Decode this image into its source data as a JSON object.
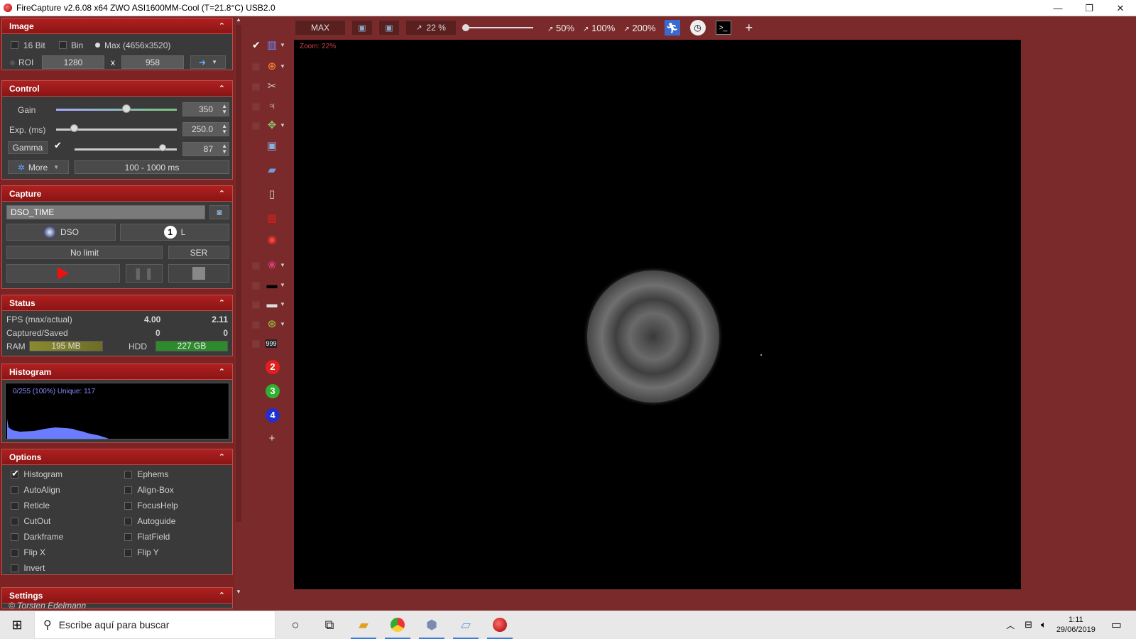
{
  "titlebar": {
    "title": "FireCapture v2.6.08  x64    ZWO ASI1600MM-Cool (T=21.8°C) USB2.0",
    "minimize": "—",
    "restore": "❐",
    "close": "✕"
  },
  "image": {
    "header": "Image",
    "bit16": "16 Bit",
    "bin": "Bin",
    "max": "Max (4656x3520)",
    "roi": "ROI",
    "roi_w": "1280",
    "x": "x",
    "roi_h": "958"
  },
  "control": {
    "header": "Control",
    "gain_label": "Gain",
    "gain_value": "350",
    "gain_level": 0.58,
    "exp_label": "Exp. (ms)",
    "exp_value": "250.0",
    "exp_level": 0.15,
    "gamma_label": "Gamma",
    "gamma_value": "87",
    "gamma_level": 0.87,
    "more": "More",
    "range": "100 - 1000 ms"
  },
  "capture": {
    "header": "Capture",
    "profile": "DSO_TIME",
    "mode": "DSO",
    "filter_num": "1",
    "filter": "L",
    "limit": "No limit",
    "format": "SER"
  },
  "status": {
    "header": "Status",
    "fps_label": "FPS (max/actual)",
    "fps_max": "4.00",
    "fps_actual": "2.11",
    "cap_label": "Captured/Saved",
    "captured": "0",
    "saved": "0",
    "ram_label": "RAM",
    "ram_value": "195 MB",
    "hdd_label": "HDD",
    "hdd_value": "227 GB"
  },
  "histogram": {
    "header": "Histogram",
    "info": "0/255 (100%)  Unique: 117"
  },
  "options": {
    "header": "Options",
    "histogram": "Histogram",
    "ephems": "Ephems",
    "autoalign": "AutoAlign",
    "alignbox": "Align-Box",
    "reticle": "Reticle",
    "focushelp": "FocusHelp",
    "cutout": "CutOut",
    "autoguide": "Autoguide",
    "darkframe": "Darkframe",
    "flatfield": "FlatField",
    "flipx": "Flip X",
    "flipy": "Flip Y",
    "invert": "Invert"
  },
  "settings": {
    "header": "Settings"
  },
  "copyright": "© Torsten Edelmann",
  "toolbar": {
    "max": "MAX",
    "zoom": "22 %",
    "z50": "50%",
    "z100": "100%",
    "z200": "200%",
    "plus": "+"
  },
  "viewport": {
    "zoom_label": "Zoom: 22%"
  },
  "tools": {
    "n999": "999",
    "n2": "2",
    "n3": "3",
    "n4": "4",
    "plus": "+"
  },
  "taskbar": {
    "search": "Escribe aquí para buscar",
    "time": "1:11",
    "date": "29/06/2019"
  }
}
